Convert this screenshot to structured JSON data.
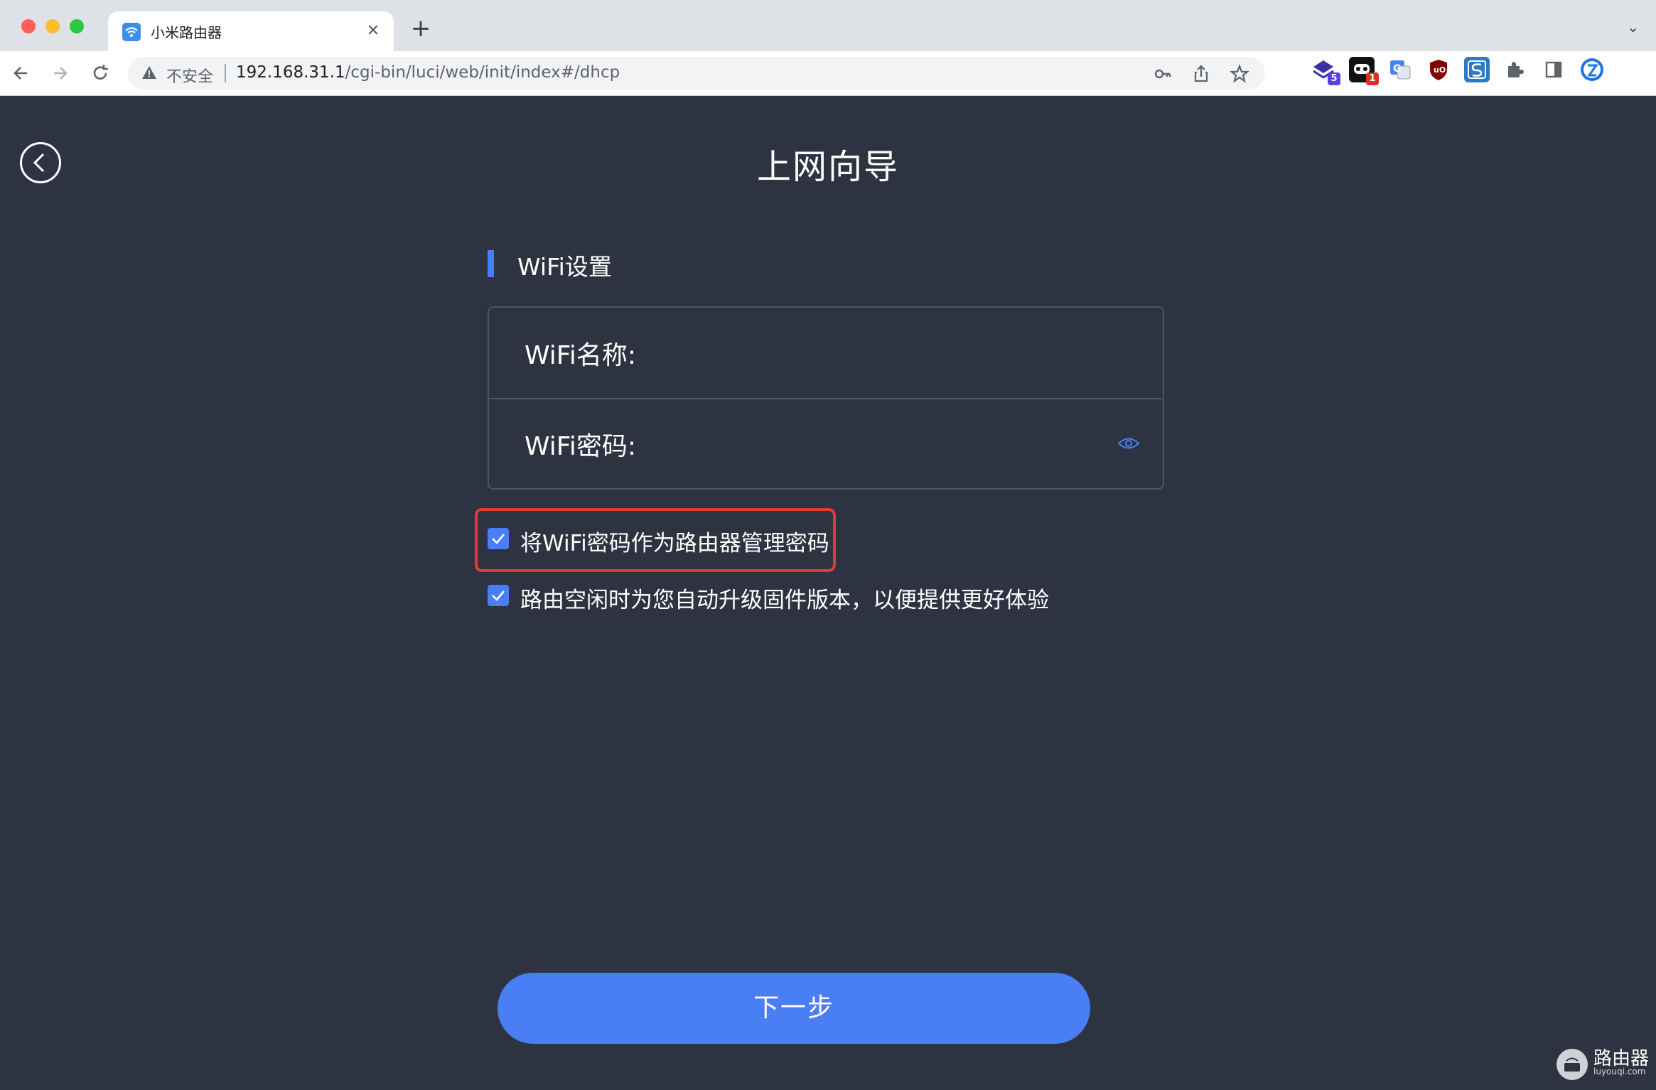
{
  "browser": {
    "tab_title": "小米路由器",
    "tab_close": "×",
    "new_tab": "+",
    "tab_menu": "⌄",
    "insecure_label": "不安全",
    "url_host": "192.168.31.1",
    "url_path": "/cgi-bin/luci/web/init/index#/dhcp",
    "omnibox_icons": [
      "key-icon",
      "share-icon",
      "star-icon"
    ],
    "extensions": [
      {
        "name": "ext-stack-icon",
        "color": "#3b2fa8",
        "badge": "5",
        "badge_color": "#5b3ee0"
      },
      {
        "name": "ext-mask-icon",
        "color": "#111111",
        "badge": "1",
        "badge_color": "#d93025"
      },
      {
        "name": "ext-translate-icon",
        "color": "#4a7ef5",
        "badge": "",
        "badge_color": ""
      },
      {
        "name": "ext-ublock-icon",
        "color": "#800000",
        "badge": "",
        "badge_color": ""
      },
      {
        "name": "ext-s-icon",
        "color": "#2b78c5",
        "badge": "",
        "badge_color": ""
      },
      {
        "name": "extensions-puzzle-icon",
        "color": "#ffffff",
        "badge": "",
        "badge_color": ""
      },
      {
        "name": "sidepanel-icon",
        "color": "#ffffff",
        "badge": "",
        "badge_color": ""
      },
      {
        "name": "profile-avatar-icon",
        "color": "#1a73e8",
        "badge": "",
        "badge_color": ""
      }
    ]
  },
  "page": {
    "title": "上网向导",
    "section_title": "WiFi设置",
    "wifi_name_label": "WiFi名称:",
    "wifi_password_label": "WiFi密码:",
    "checkbox_admin_password": {
      "label": "将WiFi密码作为路由器管理密码",
      "checked": true
    },
    "checkbox_auto_upgrade": {
      "label": "路由空闲时为您自动升级固件版本，以便提供更好体验",
      "checked": true
    },
    "next_button": "下一步",
    "accent_color": "#4a7ef5",
    "highlight_color": "#e33b2e"
  },
  "watermark": {
    "text": "路由器",
    "sub": "luyouqi.com"
  }
}
